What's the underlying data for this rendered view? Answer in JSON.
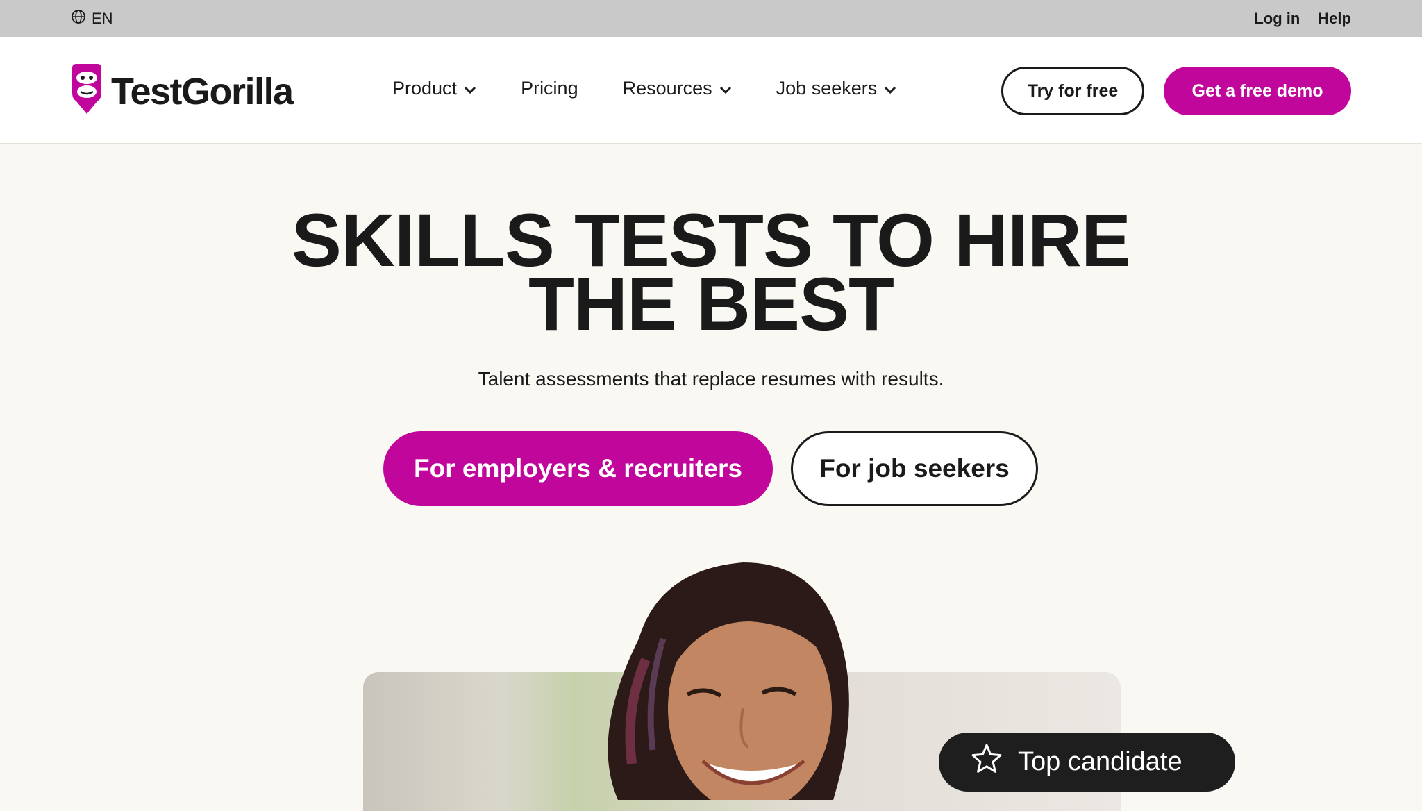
{
  "topbar": {
    "language": "EN",
    "login_label": "Log in",
    "help_label": "Help"
  },
  "nav": {
    "brand": "TestGorilla",
    "menu": {
      "product": "Product",
      "pricing": "Pricing",
      "resources": "Resources",
      "job_seekers": "Job seekers"
    },
    "try_free_label": "Try for free",
    "demo_label": "Get a free demo"
  },
  "hero": {
    "title_line1": "SKILLS TESTS TO HIRE",
    "title_line2": "THE BEST",
    "subtitle": "Talent assessments that replace resumes with results.",
    "cta_employers": "For employers & recruiters",
    "cta_job_seekers": "For job seekers"
  },
  "badge": {
    "label": "Top candidate",
    "icon": "star-icon"
  },
  "colors": {
    "brand_pink": "#c1069b",
    "text_dark": "#1a1a1a",
    "hero_bg": "#faf8f3",
    "topbar_bg": "#c9c9c9"
  }
}
